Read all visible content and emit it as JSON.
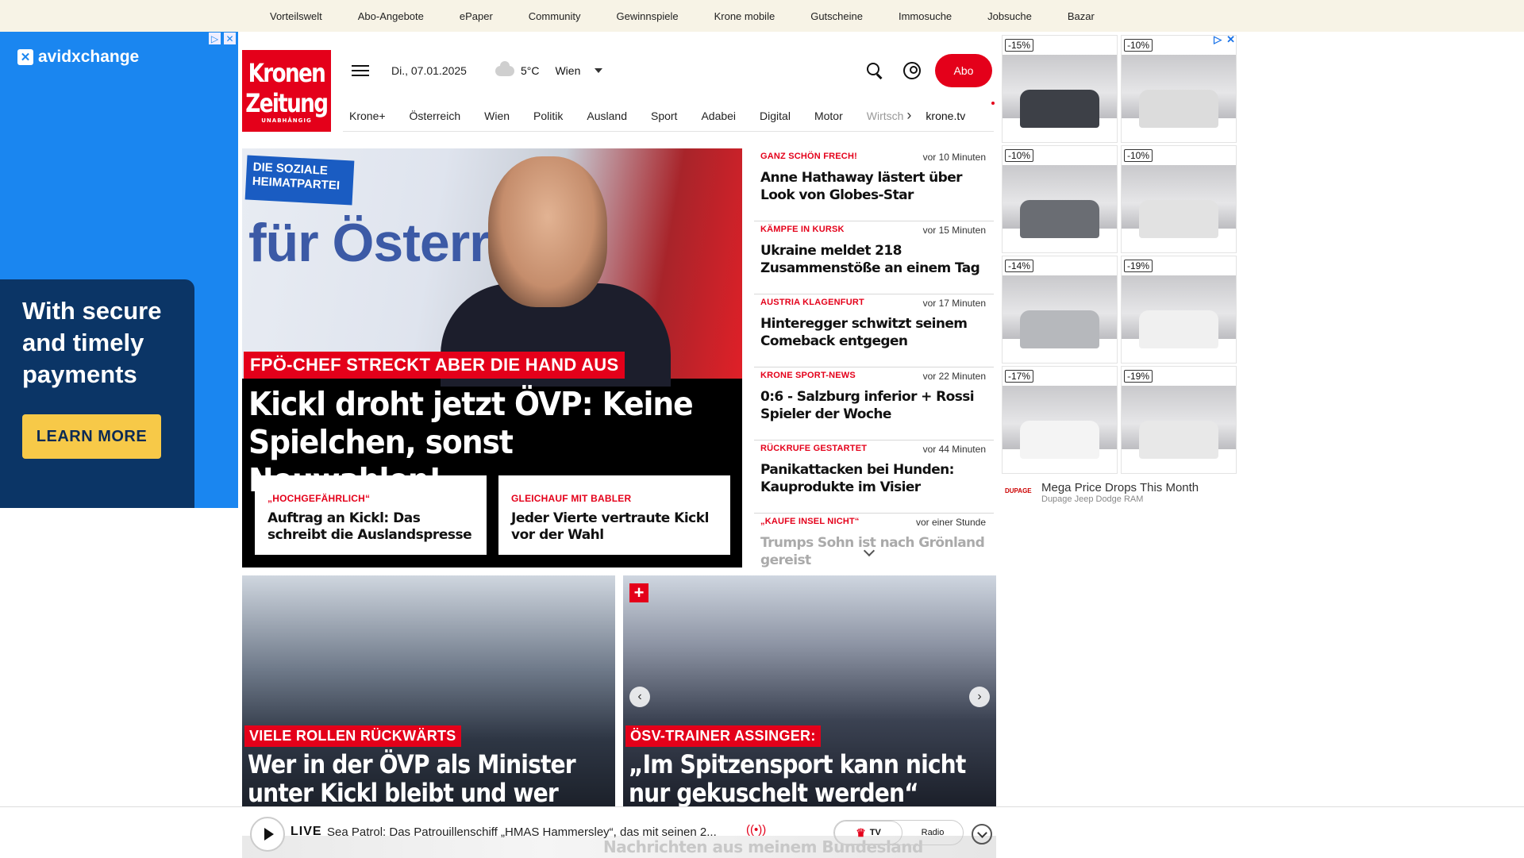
{
  "topbar": {
    "links": [
      "Vorteilswelt",
      "Abo-Angebote",
      "ePaper",
      "Community",
      "Gewinnspiele",
      "Krone mobile",
      "Gutscheine",
      "Immosuche",
      "Jobsuche",
      "Bazar"
    ]
  },
  "ad_left": {
    "brand": "avidxchange",
    "headline": "With secure and timely payments",
    "cta": "LEARN MORE"
  },
  "brand": {
    "line1": "Kronen",
    "line2": "Zeitung",
    "line3": "UNABHÄNGIG"
  },
  "header": {
    "date": "Di., 07.01.2025",
    "temperature": "5°C",
    "location": "Wien",
    "abo_label": "Abo"
  },
  "nav": {
    "items": [
      "Krone+",
      "Österreich",
      "Wien",
      "Politik",
      "Ausland",
      "Sport",
      "Adabei",
      "Digital",
      "Motor"
    ],
    "truncated": "Wirtsch",
    "tv": "krone.tv"
  },
  "hero": {
    "poster_text": "DIE SOZIALE HEIMATPARTEI",
    "poster_word": "für Österre",
    "kicker": "FPÖ-CHEF STRECKT ABER DIE HAND AUS",
    "headline": "Kickl droht jetzt ÖVP: Keine Spielchen, sonst Neuwahlen!",
    "subs": [
      {
        "kicker": "„HOCHGEFÄHRLICH“",
        "headline": "Auftrag an Kickl: Das schreibt die Auslandspresse"
      },
      {
        "kicker": "GLEICHAUF MIT BABLER",
        "headline": "Jeder Vierte vertraute Kickl vor der Wahl"
      }
    ]
  },
  "feed": {
    "items": [
      {
        "kicker": "GANZ SCHÖN FRECH!",
        "time": "vor 10 Minuten",
        "headline": "Anne Hathaway lästert über Look von Globes-Star"
      },
      {
        "kicker": "KÄMPFE IN KURSK",
        "time": "vor 15 Minuten",
        "headline": "Ukraine meldet 218 Zusammenstöße an einem Tag"
      },
      {
        "kicker": "AUSTRIA KLAGENFURT",
        "time": "vor 17 Minuten",
        "headline": "Hinteregger schwitzt seinem Comeback entgegen"
      },
      {
        "kicker": "KRONE SPORT-NEWS",
        "time": "vor 22 Minuten",
        "headline": "0:6 - Salzburg inferior + Rossi Spieler der Woche"
      },
      {
        "kicker": "RÜCKRUFE GESTARTET",
        "time": "vor 44 Minuten",
        "headline": "Panikattacken bei Hunden: Kauprodukte im Visier"
      },
      {
        "kicker": "„KAUFE INSEL NICHT“",
        "time": "vor einer Stunde",
        "headline": "Trumps Sohn ist nach Grönland gereist"
      }
    ]
  },
  "ad_right": {
    "cards": [
      {
        "discount": "-15%",
        "color": "#3d4047"
      },
      {
        "discount": "-10%",
        "color": "#dcdcdc"
      },
      {
        "discount": "-10%",
        "color": "#6a6d73"
      },
      {
        "discount": "-10%",
        "color": "#e2e2e2"
      },
      {
        "discount": "-14%",
        "color": "#b6b8bc"
      },
      {
        "discount": "-19%",
        "color": "#f0f0f0"
      },
      {
        "discount": "-17%",
        "color": "#f4f4f4"
      },
      {
        "discount": "-19%",
        "color": "#e8e8e8"
      }
    ],
    "logo": "DUPAGE",
    "title": "Mega Price Drops This Month",
    "advertiser": "Dupage Jeep Dodge RAM"
  },
  "tiles": [
    {
      "kicker": "VIELE ROLLEN RÜCKWÄRTS",
      "headline": "Wer in der ÖVP als Minister unter Kickl bleibt und wer nicht"
    },
    {
      "kicker": "ÖSV-TRAINER ASSINGER:",
      "headline": "„Im Spitzensport kann nicht nur gekuschelt werden“"
    }
  ],
  "player": {
    "live": "LIVE",
    "title": "Sea Patrol: Das Patrouillenschiff „HMAS Hammersley“, das mit seinen 2...",
    "tv": "TV",
    "radio": "Radio",
    "background_text": "Nachrichten aus meinem Bundesland"
  }
}
